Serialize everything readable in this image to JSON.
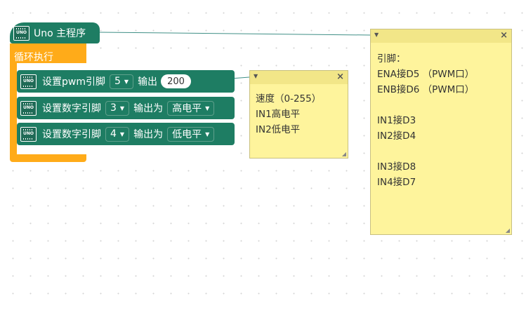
{
  "main_block": {
    "title": "Uno 主程序",
    "icon": "uno-board-icon",
    "icon_text": "UNO"
  },
  "loop_block": {
    "label": "循环执行"
  },
  "statements": [
    {
      "text": "设置pwm引脚",
      "pin": "5",
      "action": "输出",
      "value": "200",
      "icon": "uno-board-icon",
      "icon_text": "UNO"
    },
    {
      "text": "设置数字引脚",
      "pin": "3",
      "action": "输出为",
      "level": "高电平",
      "icon": "uno-board-icon",
      "icon_text": "UNO"
    },
    {
      "text": "设置数字引脚",
      "pin": "4",
      "action": "输出为",
      "level": "低电平",
      "icon": "uno-board-icon",
      "icon_text": "UNO"
    }
  ],
  "comments": [
    {
      "lines": [
        "速度（0-255）",
        "IN1高电平",
        "IN2低电平"
      ]
    },
    {
      "lines": [
        "引脚：",
        "ENA接D5 （PWM口）",
        "ENB接D6 （PWM口）",
        "",
        "IN1接D3",
        "IN2接D4",
        "",
        "IN3接D8",
        "IN4接D7"
      ]
    }
  ],
  "colors": {
    "block_green": "#1e7d63",
    "loop_orange": "#ffab19",
    "comment_yellow": "#fef49c",
    "connector_line": "#3f8f86"
  }
}
